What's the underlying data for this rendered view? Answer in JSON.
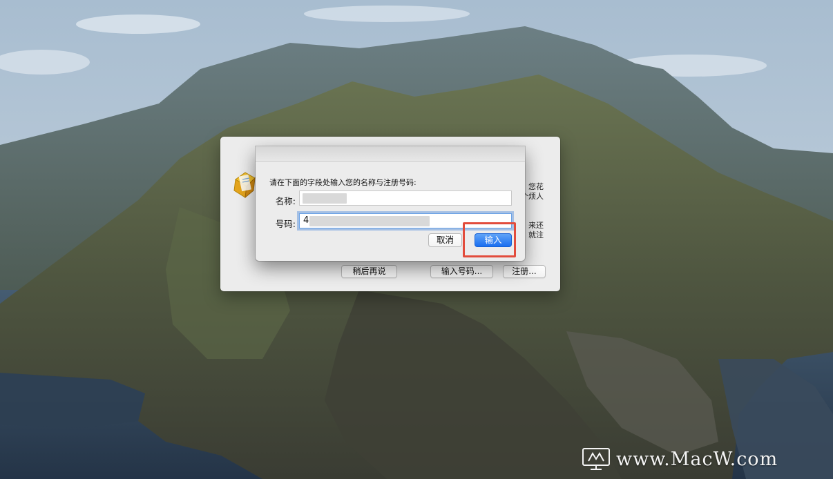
{
  "back_window": {
    "text_line1": "您花",
    "text_line2": "个烦人",
    "text_line3": "来还",
    "text_line4": "就注",
    "buttons": {
      "later": "稍后再说",
      "enter_serial": "输入号码...",
      "register": "注册..."
    }
  },
  "sheet": {
    "prompt": "请在下面的字段处输入您的名称与注册号码:",
    "name_label": "名称:",
    "name_value": "",
    "serial_label": "号码:",
    "serial_value": "4",
    "cancel_label": "取消",
    "enter_label": "输入"
  },
  "watermark": {
    "text": "www.MacW.com"
  },
  "colors": {
    "accent": "#1a6ff0",
    "highlight": "#e24c3c",
    "window_bg": "#ececec"
  }
}
